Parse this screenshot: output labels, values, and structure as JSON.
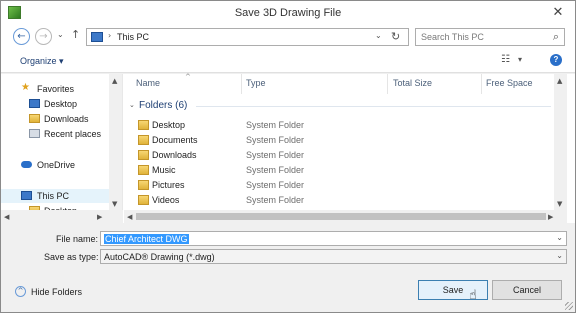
{
  "window": {
    "title": "Save 3D Drawing File"
  },
  "titlebar": {
    "close_glyph": "✕"
  },
  "nav": {
    "back_glyph": "←",
    "forward_glyph": "→",
    "recent_glyph": "⌄",
    "up_glyph": "↑",
    "path_sep": "›",
    "path": "This PC",
    "dropdown_glyph": "⌄",
    "refresh_glyph": "↻",
    "search_placeholder": "Search This PC",
    "search_glyph": "⌕"
  },
  "toolbar": {
    "organize_label": "Organize ▾",
    "view_glyph": "☷",
    "view_dd_glyph": "▾",
    "help_glyph": "?"
  },
  "sidebar": {
    "items": [
      {
        "label": "Favorites",
        "icon": "star-icon"
      },
      {
        "label": "Desktop",
        "icon": "desktop-icon"
      },
      {
        "label": "Downloads",
        "icon": "downloads-folder-icon"
      },
      {
        "label": "Recent places",
        "icon": "recent-places-icon"
      },
      {
        "label": "OneDrive",
        "icon": "onedrive-icon"
      },
      {
        "label": "This PC",
        "icon": "pc-icon"
      },
      {
        "label": "Desktop",
        "icon": "desktop-icon"
      }
    ]
  },
  "columns": [
    "Name",
    "Type",
    "Total Size",
    "Free Space"
  ],
  "group": {
    "label": "Folders (6)",
    "chevron": "⌄"
  },
  "files": [
    {
      "name": "Desktop",
      "type": "System Folder"
    },
    {
      "name": "Documents",
      "type": "System Folder"
    },
    {
      "name": "Downloads",
      "type": "System Folder"
    },
    {
      "name": "Music",
      "type": "System Folder"
    },
    {
      "name": "Pictures",
      "type": "System Folder"
    },
    {
      "name": "Videos",
      "type": "System Folder"
    }
  ],
  "form": {
    "file_name_label": "File name:",
    "file_name_value": "Chief Architect DWG",
    "save_type_label": "Save as type:",
    "save_type_value": "AutoCAD® Drawing (*.dwg)",
    "dropdown_glyph": "⌄"
  },
  "footer": {
    "hide_folders_label": "Hide Folders",
    "hide_folders_glyph": "^",
    "save_label": "Save",
    "cancel_label": "Cancel"
  },
  "scroll": {
    "up": "▲",
    "down": "▼",
    "left": "◀",
    "right": "▶"
  },
  "colors": {
    "accent": "#3399ff",
    "title_text": "#333333",
    "link_text": "#1e3f73"
  }
}
